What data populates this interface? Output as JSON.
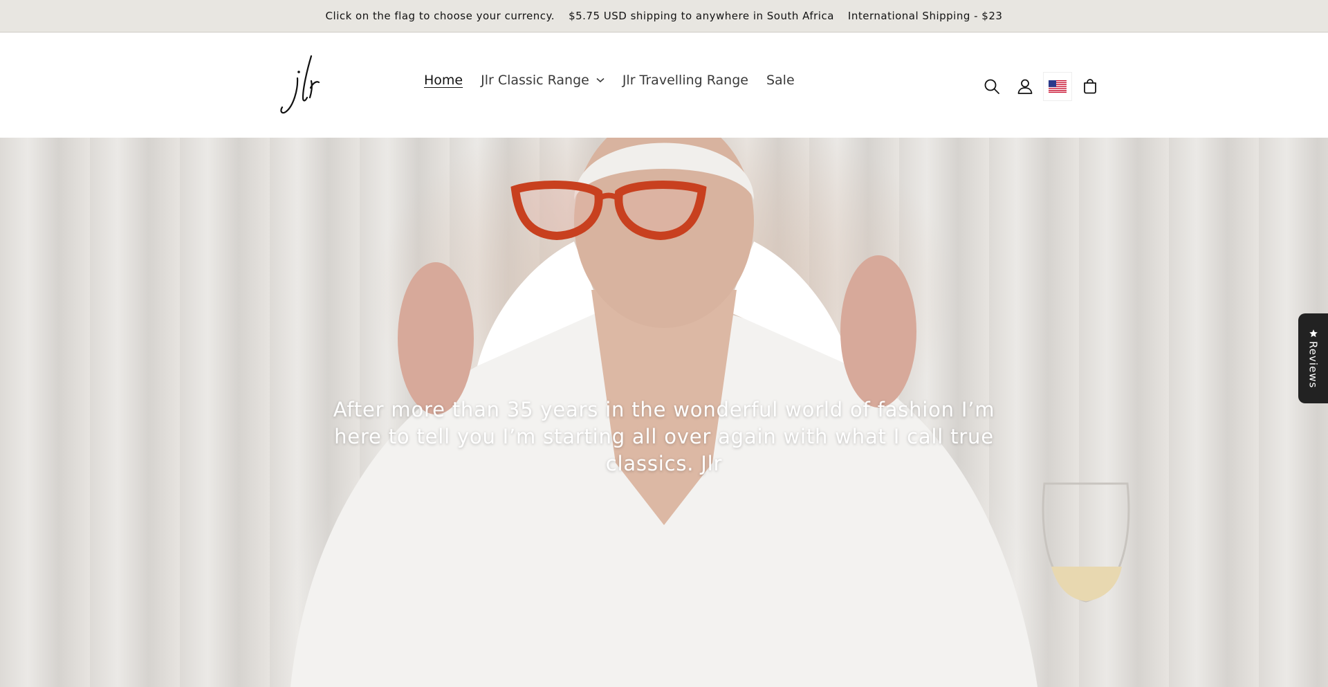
{
  "announcement": {
    "items": [
      "Click on the flag to choose your currency.",
      "$5.75 USD shipping to anywhere in South Africa",
      "International Shipping - $23"
    ]
  },
  "header": {
    "logo_text": "jlr",
    "nav": [
      {
        "label": "Home",
        "active": true
      },
      {
        "label": "Jlr Classic Range",
        "has_dropdown": true
      },
      {
        "label": "Jlr Travelling Range"
      },
      {
        "label": "Sale"
      }
    ],
    "icons": [
      "search-icon",
      "account-icon",
      "us-flag-icon",
      "cart-icon"
    ]
  },
  "hero": {
    "text": "After more than 35 years in the wonderful world of fashion I’m here to tell you I’m starting all over again with what I call true classics. Jlr"
  },
  "reviews_tab": {
    "label": "Reviews",
    "icon": "star-icon"
  },
  "colors": {
    "announcement_bg": "#e8e6e1",
    "reviews_bg": "#222222",
    "text": "#121212"
  }
}
